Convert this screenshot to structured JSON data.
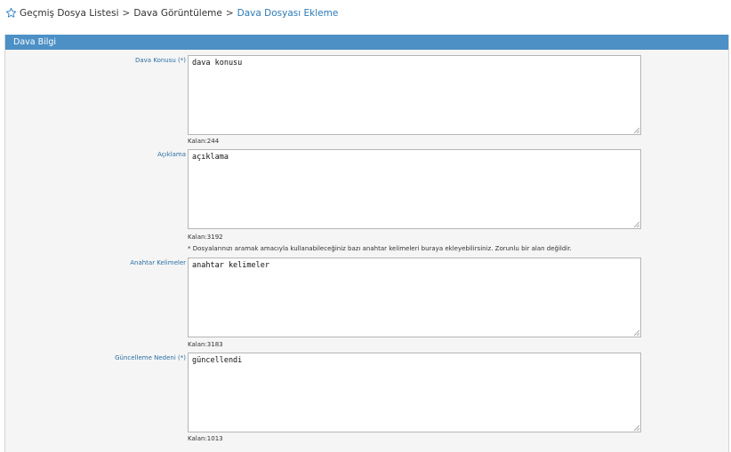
{
  "breadcrumb": {
    "items": [
      "Geçmiş Dosya Listesi",
      "Dava Görüntüleme"
    ],
    "separator": ">",
    "current": "Dava Dosyası Ekleme"
  },
  "panel": {
    "title": "Dava Bilgi"
  },
  "fields": [
    {
      "label": "Dava Konusu (*)",
      "value": "dava konusu",
      "remaining": "Kalan:244"
    },
    {
      "label": "Açıklama",
      "value": "açıklama",
      "remaining": "Kalan:3192"
    },
    {
      "label": "Anahtar Kelimeler",
      "value": "anahtar kelimeler",
      "remaining": "Kalan:3183",
      "hint": "* Dosyalarınızı aramak amacıyla kullanabileceğiniz bazı anahtar kelimeleri buraya ekleyebilirsiniz. Zorunlu bir alan değildir."
    },
    {
      "label": "Güncelleme Nedeni (*)",
      "value": "güncellendi",
      "remaining": "Kalan:1013"
    }
  ],
  "colors": {
    "header_bg": "#4c90c6",
    "label_blue": "#2a6fa5",
    "breadcrumb_current": "#2a7ab8"
  },
  "icons": {
    "breadcrumb": "star-outline-icon"
  }
}
